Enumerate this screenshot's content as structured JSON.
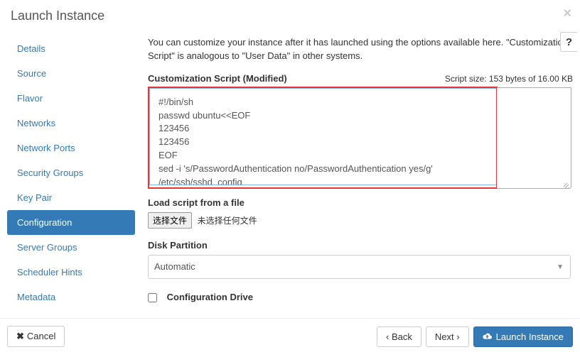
{
  "header": {
    "title": "Launch Instance"
  },
  "sidebar": {
    "items": [
      {
        "label": "Details"
      },
      {
        "label": "Source"
      },
      {
        "label": "Flavor"
      },
      {
        "label": "Networks"
      },
      {
        "label": "Network Ports"
      },
      {
        "label": "Security Groups"
      },
      {
        "label": "Key Pair"
      },
      {
        "label": "Configuration"
      },
      {
        "label": "Server Groups"
      },
      {
        "label": "Scheduler Hints"
      },
      {
        "label": "Metadata"
      }
    ],
    "active_index": 7
  },
  "main": {
    "intro": "You can customize your instance after it has launched using the options available here. \"Customization Script\" is analogous to \"User Data\" in other systems.",
    "script_label": "Customization Script (Modified)",
    "script_size_text": "Script size: 153 bytes of 16.00 KB",
    "script_value": "#!/bin/sh\npasswd ubuntu<<EOF\n123456\n123456\nEOF\nsed -i 's/PasswordAuthentication no/PasswordAuthentication yes/g' /etc/ssh/sshd_config\nservice ssh restart",
    "load_file_label": "Load script from a file",
    "file_button": "选择文件",
    "file_status": "未选择任何文件",
    "partition_label": "Disk Partition",
    "partition_value": "Automatic",
    "config_drive_label": "Configuration Drive",
    "config_drive_checked": false
  },
  "footer": {
    "cancel": "Cancel",
    "back": "Back",
    "next": "Next",
    "launch": "Launch Instance"
  }
}
